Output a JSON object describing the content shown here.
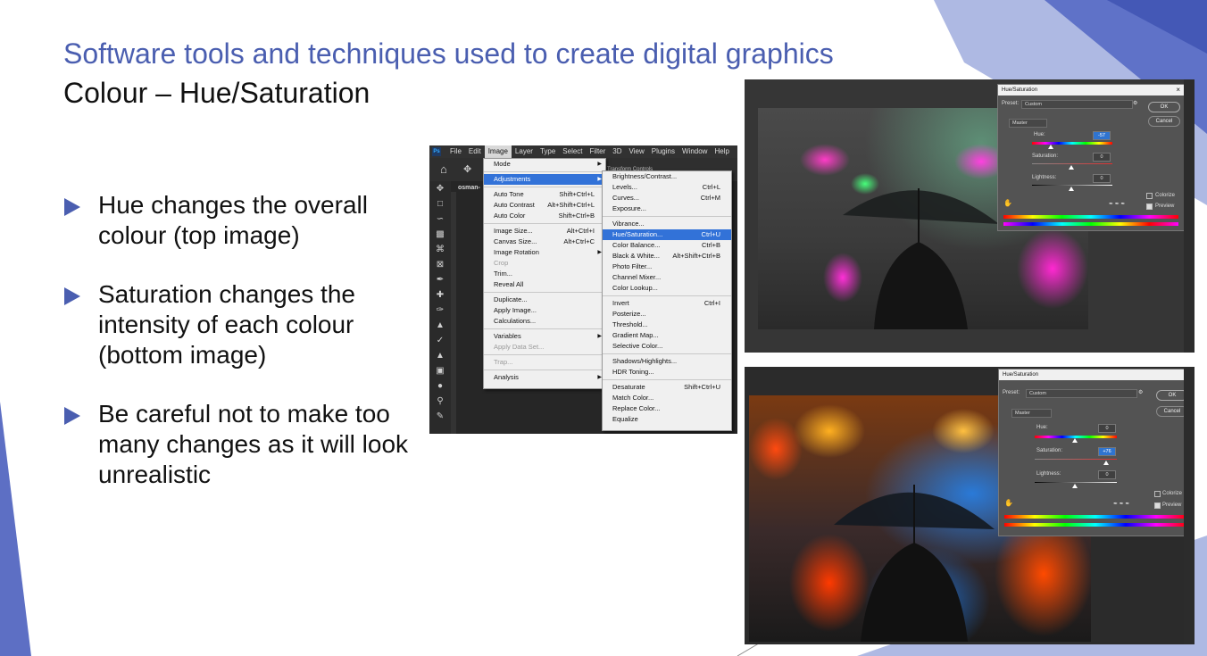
{
  "slide": {
    "title": "Software tools and techniques used to create digital graphics",
    "subtitle": "Colour – Hue/Saturation",
    "accent_color": "#4a5eb0",
    "bullets": [
      "Hue changes the overall colour (top image)",
      "Saturation changes the intensity of each colour (bottom image)",
      "Be careful not to make too many changes as it will look unrealistic"
    ]
  },
  "photoshop": {
    "menubar": [
      "Ps",
      "File",
      "Edit",
      "Image",
      "Layer",
      "Type",
      "Select",
      "Filter",
      "3D",
      "View",
      "Plugins",
      "Window",
      "Help"
    ],
    "active_menu": "Image",
    "options_bar": {
      "transform_controls": "Transform Controls"
    },
    "doc_tab": "osman-",
    "image_menu": [
      {
        "label": "Mode",
        "shortcut": "",
        "submenu": true
      },
      {
        "sep": true
      },
      {
        "label": "Adjustments",
        "shortcut": "",
        "submenu": true,
        "highlight": true
      },
      {
        "sep": true
      },
      {
        "label": "Auto Tone",
        "shortcut": "Shift+Ctrl+L"
      },
      {
        "label": "Auto Contrast",
        "shortcut": "Alt+Shift+Ctrl+L"
      },
      {
        "label": "Auto Color",
        "shortcut": "Shift+Ctrl+B"
      },
      {
        "sep": true
      },
      {
        "label": "Image Size...",
        "shortcut": "Alt+Ctrl+I"
      },
      {
        "label": "Canvas Size...",
        "shortcut": "Alt+Ctrl+C"
      },
      {
        "label": "Image Rotation",
        "shortcut": "",
        "submenu": true
      },
      {
        "label": "Crop",
        "shortcut": "",
        "disabled": true
      },
      {
        "label": "Trim...",
        "shortcut": ""
      },
      {
        "label": "Reveal All",
        "shortcut": ""
      },
      {
        "sep": true
      },
      {
        "label": "Duplicate...",
        "shortcut": ""
      },
      {
        "label": "Apply Image...",
        "shortcut": ""
      },
      {
        "label": "Calculations...",
        "shortcut": ""
      },
      {
        "sep": true
      },
      {
        "label": "Variables",
        "shortcut": "",
        "submenu": true
      },
      {
        "label": "Apply Data Set...",
        "shortcut": "",
        "disabled": true
      },
      {
        "sep": true
      },
      {
        "label": "Trap...",
        "shortcut": "",
        "disabled": true
      },
      {
        "sep": true
      },
      {
        "label": "Analysis",
        "shortcut": "",
        "submenu": true
      }
    ],
    "adjustments_menu": [
      {
        "label": "Brightness/Contrast...",
        "shortcut": ""
      },
      {
        "label": "Levels...",
        "shortcut": "Ctrl+L"
      },
      {
        "label": "Curves...",
        "shortcut": "Ctrl+M"
      },
      {
        "label": "Exposure...",
        "shortcut": ""
      },
      {
        "sep": true
      },
      {
        "label": "Vibrance...",
        "shortcut": ""
      },
      {
        "label": "Hue/Saturation...",
        "shortcut": "Ctrl+U",
        "highlight": true
      },
      {
        "label": "Color Balance...",
        "shortcut": "Ctrl+B"
      },
      {
        "label": "Black & White...",
        "shortcut": "Alt+Shift+Ctrl+B"
      },
      {
        "label": "Photo Filter...",
        "shortcut": ""
      },
      {
        "label": "Channel Mixer...",
        "shortcut": ""
      },
      {
        "label": "Color Lookup...",
        "shortcut": ""
      },
      {
        "sep": true
      },
      {
        "label": "Invert",
        "shortcut": "Ctrl+I"
      },
      {
        "label": "Posterize...",
        "shortcut": ""
      },
      {
        "label": "Threshold...",
        "shortcut": ""
      },
      {
        "label": "Gradient Map...",
        "shortcut": ""
      },
      {
        "label": "Selective Color...",
        "shortcut": ""
      },
      {
        "sep": true
      },
      {
        "label": "Shadows/Highlights...",
        "shortcut": ""
      },
      {
        "label": "HDR Toning...",
        "shortcut": ""
      },
      {
        "sep": true
      },
      {
        "label": "Desaturate",
        "shortcut": "Shift+Ctrl+U"
      },
      {
        "label": "Match Color...",
        "shortcut": ""
      },
      {
        "label": "Replace Color...",
        "shortcut": ""
      },
      {
        "label": "Equalize",
        "shortcut": ""
      }
    ]
  },
  "dialog_top": {
    "title": "Hue/Saturation",
    "preset_label": "Preset:",
    "preset_value": "Custom",
    "channel": "Master",
    "hue_label": "Hue:",
    "hue_value": "-57",
    "saturation_label": "Saturation:",
    "saturation_value": "0",
    "lightness_label": "Lightness:",
    "lightness_value": "0",
    "ok": "OK",
    "cancel": "Cancel",
    "colorize": "Colorize",
    "preview": "Preview"
  },
  "dialog_bottom": {
    "title": "Hue/Saturation",
    "preset_label": "Preset:",
    "preset_value": "Custom",
    "channel": "Master",
    "hue_label": "Hue:",
    "hue_value": "0",
    "saturation_label": "Saturation:",
    "saturation_value": "+76",
    "lightness_label": "Lightness:",
    "lightness_value": "0",
    "ok": "OK",
    "cancel": "Cancel",
    "colorize": "Colorize",
    "preview": "Preview"
  }
}
